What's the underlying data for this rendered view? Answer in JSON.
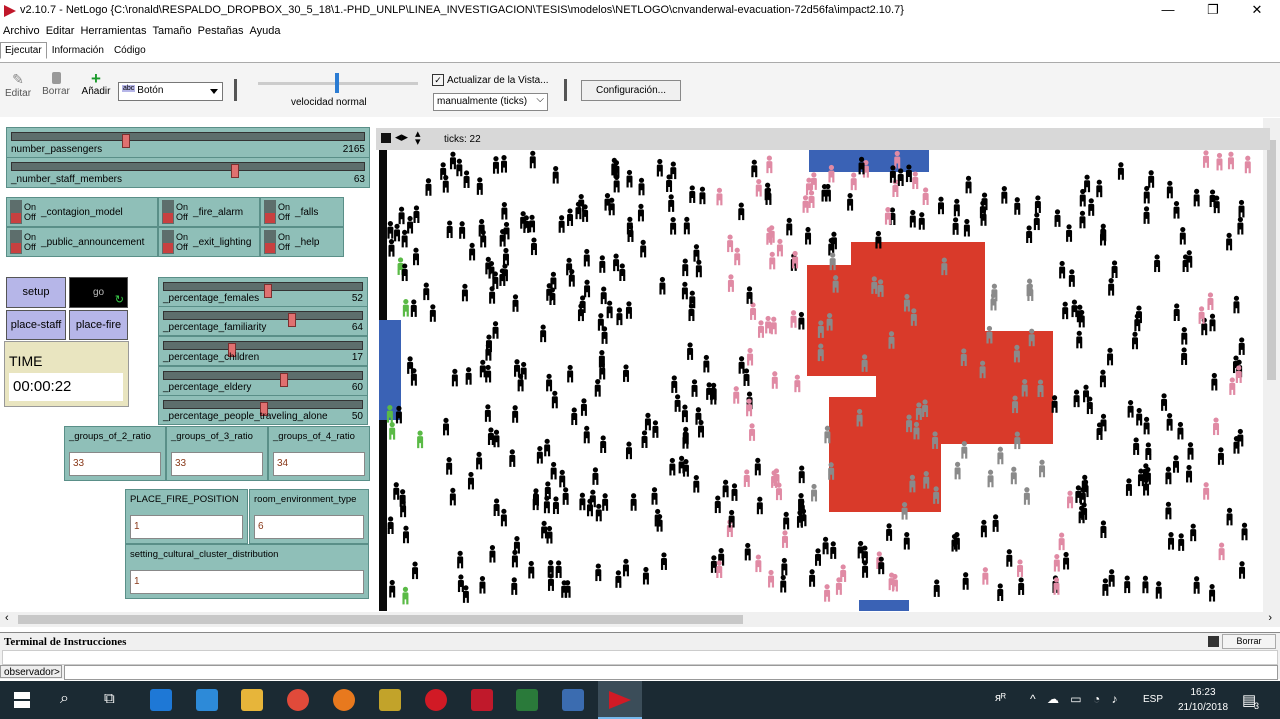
{
  "window": {
    "title": "v2.10.7 - NetLogo {C:\\ronald\\RESPALDO_DROPBOX_30_5_18\\1.-PHD_UNLP\\LINEA_INVESTIGACION\\TESIS\\modelos\\NETLOGO\\cnvanderwal-evacuation-72d56fa\\impact2.10.7}",
    "minimize": "—",
    "maximize": "❐",
    "close": "✕"
  },
  "menu": [
    "Archivo",
    "Editar",
    "Herramientas",
    "Tamaño",
    "Pestañas",
    "Ayuda"
  ],
  "tabs": [
    "Ejecutar",
    "Información",
    "Código"
  ],
  "toolbar": {
    "edit": "Editar",
    "delete": "Borrar",
    "add": "Añadir",
    "widget_type": "Botón",
    "widget_type_icon": "abc",
    "speed_label": "velocidad normal",
    "update_view": "Actualizar de la Vista...",
    "update_mode": "manualmente (ticks)",
    "settings": "Configuración..."
  },
  "sliders_top": [
    {
      "label": "number_passengers",
      "value": "2165",
      "fraction": 0.32
    },
    {
      "label": "_number_staff_members",
      "value": "63",
      "fraction": 0.63
    }
  ],
  "switches": [
    {
      "label": "_contagion_model"
    },
    {
      "label": "_fire_alarm"
    },
    {
      "label": "_falls"
    },
    {
      "label": "_public_announcement"
    },
    {
      "label": "_exit_lighting"
    },
    {
      "label": "_help"
    }
  ],
  "switch_on": "On",
  "switch_off": "Off",
  "buttons": {
    "setup": "setup",
    "go": "go",
    "place_staff": "place-staff",
    "place_fire": "place-fire"
  },
  "time_monitor": {
    "label": "TIME",
    "value": "00:00:22"
  },
  "sliders_right": [
    {
      "label": "_percentage_females",
      "value": "52",
      "fraction": 0.52
    },
    {
      "label": "_percentage_familiarity",
      "value": "64",
      "fraction": 0.64
    },
    {
      "label": "_percentage_children",
      "value": "17",
      "fraction": 0.34
    },
    {
      "label": "_percentage_eldery",
      "value": "60",
      "fraction": 0.6
    },
    {
      "label": "_percentage_people_traveling_alone",
      "value": "50",
      "fraction": 0.5
    }
  ],
  "inputs_groups": [
    {
      "label": "_groups_of_2_ratio",
      "value": "33"
    },
    {
      "label": "_groups_of_3_ratio",
      "value": "33"
    },
    {
      "label": "_groups_of_4_ratio",
      "value": "34"
    }
  ],
  "inputs_env": [
    {
      "label": "PLACE_FIRE_POSITION",
      "value": "1"
    },
    {
      "label": "room_environment_type",
      "value": "6"
    }
  ],
  "input_cultural": {
    "label": "setting_cultural_cluster_distribution",
    "value": "1"
  },
  "view": {
    "ticks": "ticks: 22"
  },
  "terminal": {
    "title": "Terminal de Instrucciones",
    "clear": "Borrar",
    "prompt": "observador>"
  },
  "taskbar": {
    "lang": "ESP",
    "time": "16:23",
    "date": "21/10/2018",
    "notifications": "3",
    "tray_user": "ᴙᴿ"
  },
  "colors": {
    "widget": "#8fbfb8",
    "button": "#b6b6e8",
    "fire": "#d93a2a",
    "agent_black": "#000000",
    "agent_pink": "#e08aa4",
    "agent_green": "#5aba46",
    "agent_gray": "#8a8a8a",
    "exit_blue": "#3a62b5"
  }
}
